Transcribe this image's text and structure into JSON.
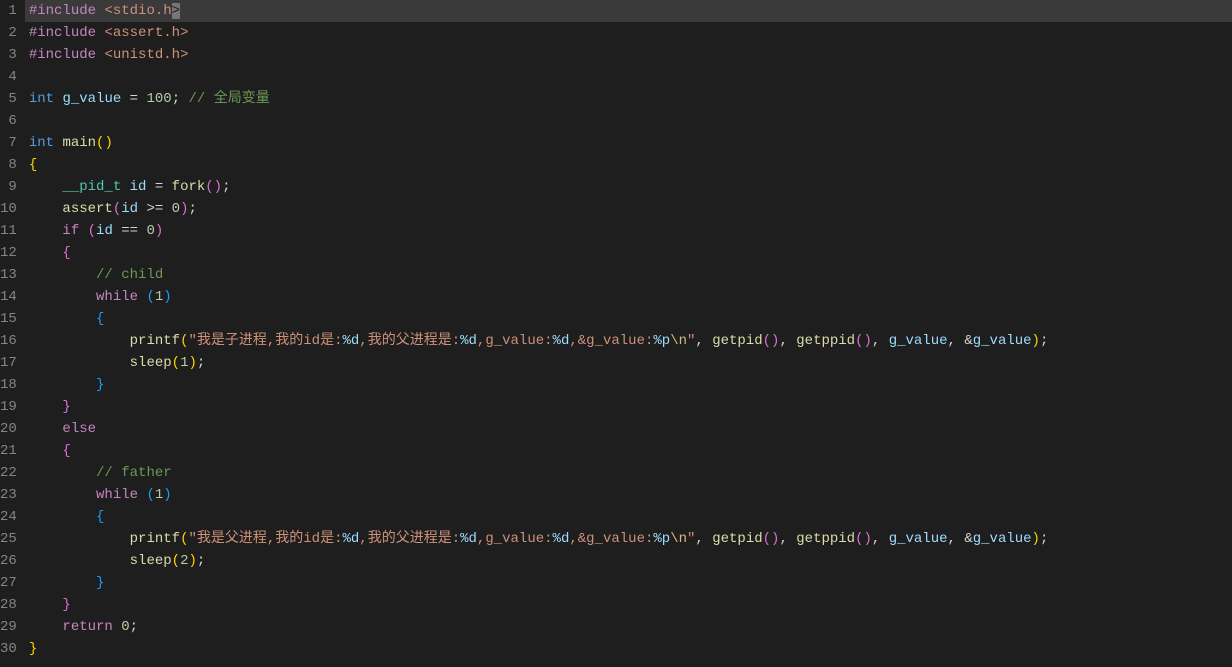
{
  "lines": {
    "l1": {
      "num": "1",
      "include": "#include",
      "lt": "<",
      "path": "stdio.h",
      "gt": ">"
    },
    "l2": {
      "num": "2",
      "include": "#include",
      "lt": "<",
      "path": "assert.h",
      "gt": ">"
    },
    "l3": {
      "num": "3",
      "include": "#include",
      "lt": "<",
      "path": "unistd.h",
      "gt": ">"
    },
    "l4": {
      "num": "4"
    },
    "l5": {
      "num": "5",
      "kw_int": "int",
      "var": "g_value",
      "eq": " = ",
      "val": "100",
      "semi": ";",
      "comment": "// 全局变量"
    },
    "l6": {
      "num": "6"
    },
    "l7": {
      "num": "7",
      "kw_int": "int",
      "fn": "main",
      "paren": "()"
    },
    "l8": {
      "num": "8",
      "brace": "{"
    },
    "l9": {
      "num": "9",
      "indent": "    ",
      "type": "__pid_t",
      "var": "id",
      "eq": " = ",
      "fn": "fork",
      "paren": "()",
      "semi": ";"
    },
    "l10": {
      "num": "10",
      "indent": "    ",
      "fn": "assert",
      "lp": "(",
      "var": "id",
      "op": " >= ",
      "val": "0",
      "rp": ")",
      "semi": ";"
    },
    "l11": {
      "num": "11",
      "indent": "    ",
      "kw": "if",
      "sp": " ",
      "lp": "(",
      "var": "id",
      "op": " == ",
      "val": "0",
      "rp": ")"
    },
    "l12": {
      "num": "12",
      "indent": "    ",
      "brace": "{"
    },
    "l13": {
      "num": "13",
      "indent": "        ",
      "comment": "// child"
    },
    "l14": {
      "num": "14",
      "indent": "        ",
      "kw": "while",
      "sp": " ",
      "lp": "(",
      "val": "1",
      "rp": ")"
    },
    "l15": {
      "num": "15",
      "indent": "        ",
      "brace": "{"
    },
    "l16": {
      "num": "16",
      "indent": "            ",
      "fn": "printf",
      "lp": "(",
      "q1": "\"",
      "s1": "我是子进程,我的id是:",
      "f1": "%d",
      "s2": ",我的父进程是:",
      "f2": "%d",
      "s3": ",g_value:",
      "f3": "%d",
      "s4": ",&g_value:",
      "f4": "%p",
      "esc": "\\n",
      "q2": "\"",
      "c1": ", ",
      "fn2": "getpid",
      "p2": "()",
      "c2": ", ",
      "fn3": "getppid",
      "p3": "()",
      "c3": ", ",
      "var1": "g_value",
      "c4": ", &",
      "var2": "g_value",
      "rp": ")",
      "semi": ";"
    },
    "l17": {
      "num": "17",
      "indent": "            ",
      "fn": "sleep",
      "lp": "(",
      "val": "1",
      "rp": ")",
      "semi": ";"
    },
    "l18": {
      "num": "18",
      "indent": "        ",
      "brace": "}"
    },
    "l19": {
      "num": "19",
      "indent": "    ",
      "brace": "}"
    },
    "l20": {
      "num": "20",
      "indent": "    ",
      "kw": "else"
    },
    "l21": {
      "num": "21",
      "indent": "    ",
      "brace": "{"
    },
    "l22": {
      "num": "22",
      "indent": "        ",
      "comment": "// father"
    },
    "l23": {
      "num": "23",
      "indent": "        ",
      "kw": "while",
      "sp": " ",
      "lp": "(",
      "val": "1",
      "rp": ")"
    },
    "l24": {
      "num": "24",
      "indent": "        ",
      "brace": "{"
    },
    "l25": {
      "num": "25",
      "indent": "            ",
      "fn": "printf",
      "lp": "(",
      "q1": "\"",
      "s1": "我是父进程,我的id是:",
      "f1": "%d",
      "s2": ",我的父进程是:",
      "f2": "%d",
      "s3": ",g_value:",
      "f3": "%d",
      "s4": ",&g_value:",
      "f4": "%p",
      "esc": "\\n",
      "q2": "\"",
      "c1": ", ",
      "fn2": "getpid",
      "p2": "()",
      "c2": ", ",
      "fn3": "getppid",
      "p3": "()",
      "c3": ", ",
      "var1": "g_value",
      "c4": ", &",
      "var2": "g_value",
      "rp": ")",
      "semi": ";"
    },
    "l26": {
      "num": "26",
      "indent": "            ",
      "fn": "sleep",
      "lp": "(",
      "val": "2",
      "rp": ")",
      "semi": ";"
    },
    "l27": {
      "num": "27",
      "indent": "        ",
      "brace": "}"
    },
    "l28": {
      "num": "28",
      "indent": "    ",
      "brace": "}"
    },
    "l29": {
      "num": "29",
      "indent": "    ",
      "kw": "return",
      "sp": " ",
      "val": "0",
      "semi": ";"
    },
    "l30": {
      "num": "30",
      "brace": "}"
    }
  }
}
